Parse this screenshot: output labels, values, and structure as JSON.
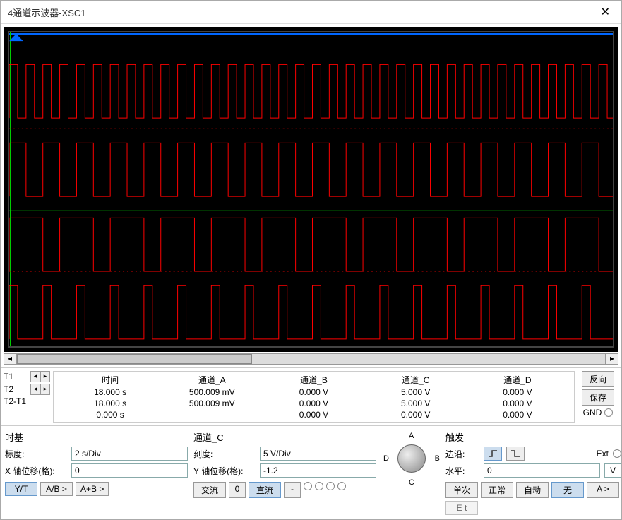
{
  "window": {
    "title": "4通道示波器-XSC1"
  },
  "readout": {
    "headers": [
      "时间",
      "通道_A",
      "通道_B",
      "通道_C",
      "通道_D"
    ],
    "t1_label": "T1",
    "t2_label": "T2",
    "t21_label": "T2-T1",
    "rows": [
      [
        "18.000 s",
        "500.009 mV",
        "0.000 V",
        "5.000 V",
        "0.000 V"
      ],
      [
        "18.000 s",
        "500.009 mV",
        "0.000 V",
        "5.000 V",
        "0.000 V"
      ],
      [
        "0.000 s",
        "",
        "0.000 V",
        "0.000 V",
        "0.000 V"
      ]
    ]
  },
  "side": {
    "reverse": "反向",
    "save": "保存",
    "gnd": "GND"
  },
  "timebase": {
    "title": "时基",
    "scale_label": "标度:",
    "scale_num": "2",
    "scale_unit": "s/Div",
    "xpos_label": "X 轴位移(格):",
    "xpos_val": "0",
    "yt": "Y/T",
    "ab": "A/B >",
    "aplusb": "A+B >"
  },
  "channel": {
    "title": "通道_C",
    "scale_label": "刻度:",
    "scale_num": "5",
    "scale_unit": "V/Div",
    "ypos_label": "Y 轴位移(格):",
    "ypos_val": "-1.2",
    "ac": "交流",
    "zero": "0",
    "dc": "直流",
    "minus": "-",
    "dial": {
      "a": "A",
      "b": "B",
      "c": "C",
      "d": "D"
    }
  },
  "trigger": {
    "title": "触发",
    "edge_label": "边沿:",
    "level_label": "水平:",
    "level_val": "0",
    "level_unit": "V",
    "ext_label": "Ext",
    "single": "单次",
    "normal": "正常",
    "auto": "自动",
    "none": "无",
    "agt": "A >",
    "et": "E t"
  }
}
